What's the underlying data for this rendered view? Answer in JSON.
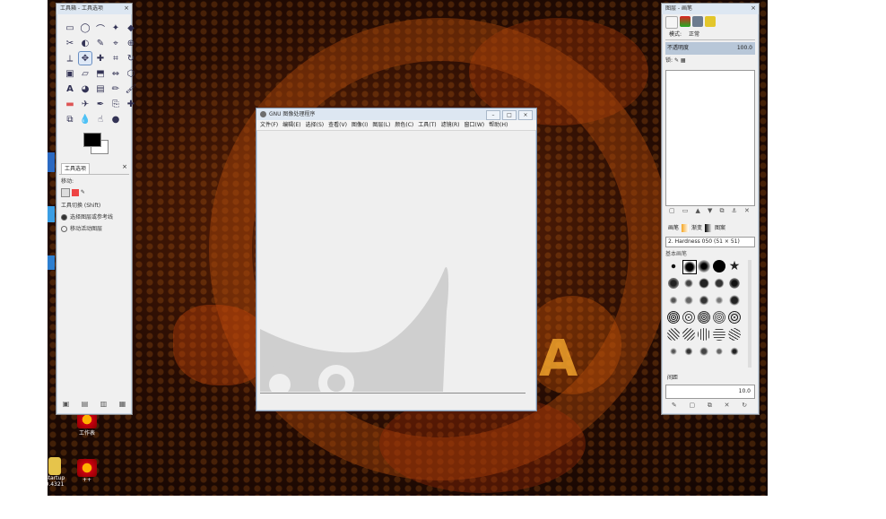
{
  "toolbox": {
    "title": "工具箱 - 工具选项",
    "tab_label": "工具选项",
    "option_line1": "移动:",
    "option_line2": "工具切换  (Shift)",
    "option_radio1": "选择图层或参考线",
    "option_radio2": "移动活动图层"
  },
  "mainwin": {
    "title": "GNU 图像处理程序",
    "menus": [
      "文件(F)",
      "编辑(E)",
      "选择(S)",
      "查看(V)",
      "图像(I)",
      "图层(L)",
      "颜色(C)",
      "工具(T)",
      "滤镜(R)",
      "窗口(W)",
      "帮助(H)"
    ]
  },
  "dock": {
    "title": "图层 - 画笔",
    "tabs": [
      "模式:",
      "正常"
    ],
    "layer_name": "不透明度",
    "layer_value": "100.0",
    "lock_label": "锁:",
    "brush_tabs": [
      "画笔",
      "渐变",
      "图案"
    ],
    "brush_select": "2. Hardness 050 (51 × 51)",
    "brush_caption": "基本画笔",
    "spacing_label": "间距",
    "spacing_value": "10.0"
  },
  "desktop_icons": [
    {
      "label": "工作表"
    },
    {
      "label": "Startup 0.4321"
    },
    {
      "label": "++"
    }
  ]
}
